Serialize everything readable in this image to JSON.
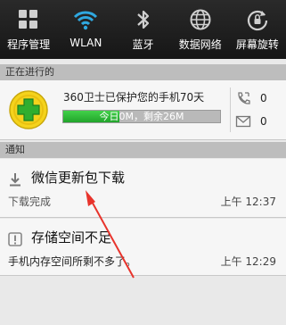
{
  "quick_toggles": [
    {
      "label": "程序管理",
      "icon": "app-grid-icon"
    },
    {
      "label": "WLAN",
      "icon": "wifi-icon"
    },
    {
      "label": "蓝牙",
      "icon": "bluetooth-icon"
    },
    {
      "label": "数据网络",
      "icon": "globe-icon"
    },
    {
      "label": "屏幕旋转",
      "icon": "rotate-lock-icon"
    }
  ],
  "ongoing": {
    "header": "正在进行的",
    "title": "360卫士已保护您的手机70天",
    "progress_text": "今日0M，剩余26M",
    "progress_fraction": 0.36,
    "missed_calls": "0",
    "unread_messages": "0"
  },
  "notifications": {
    "header": "通知",
    "items": [
      {
        "title": "微信更新包下载",
        "subtitle": "下载完成",
        "time": "上午 12:37",
        "icon": "download-icon"
      },
      {
        "title": "存储空间不足",
        "subtitle": "手机内存空间所剩不多了。",
        "time": "上午 12:29",
        "icon": "warning-icon"
      }
    ]
  },
  "colors": {
    "toggle_bar": "#1e1e1e",
    "wifi_accent": "#2fa8e0",
    "progress_green": "#2bb334",
    "annotation_arrow": "#e8342c"
  }
}
